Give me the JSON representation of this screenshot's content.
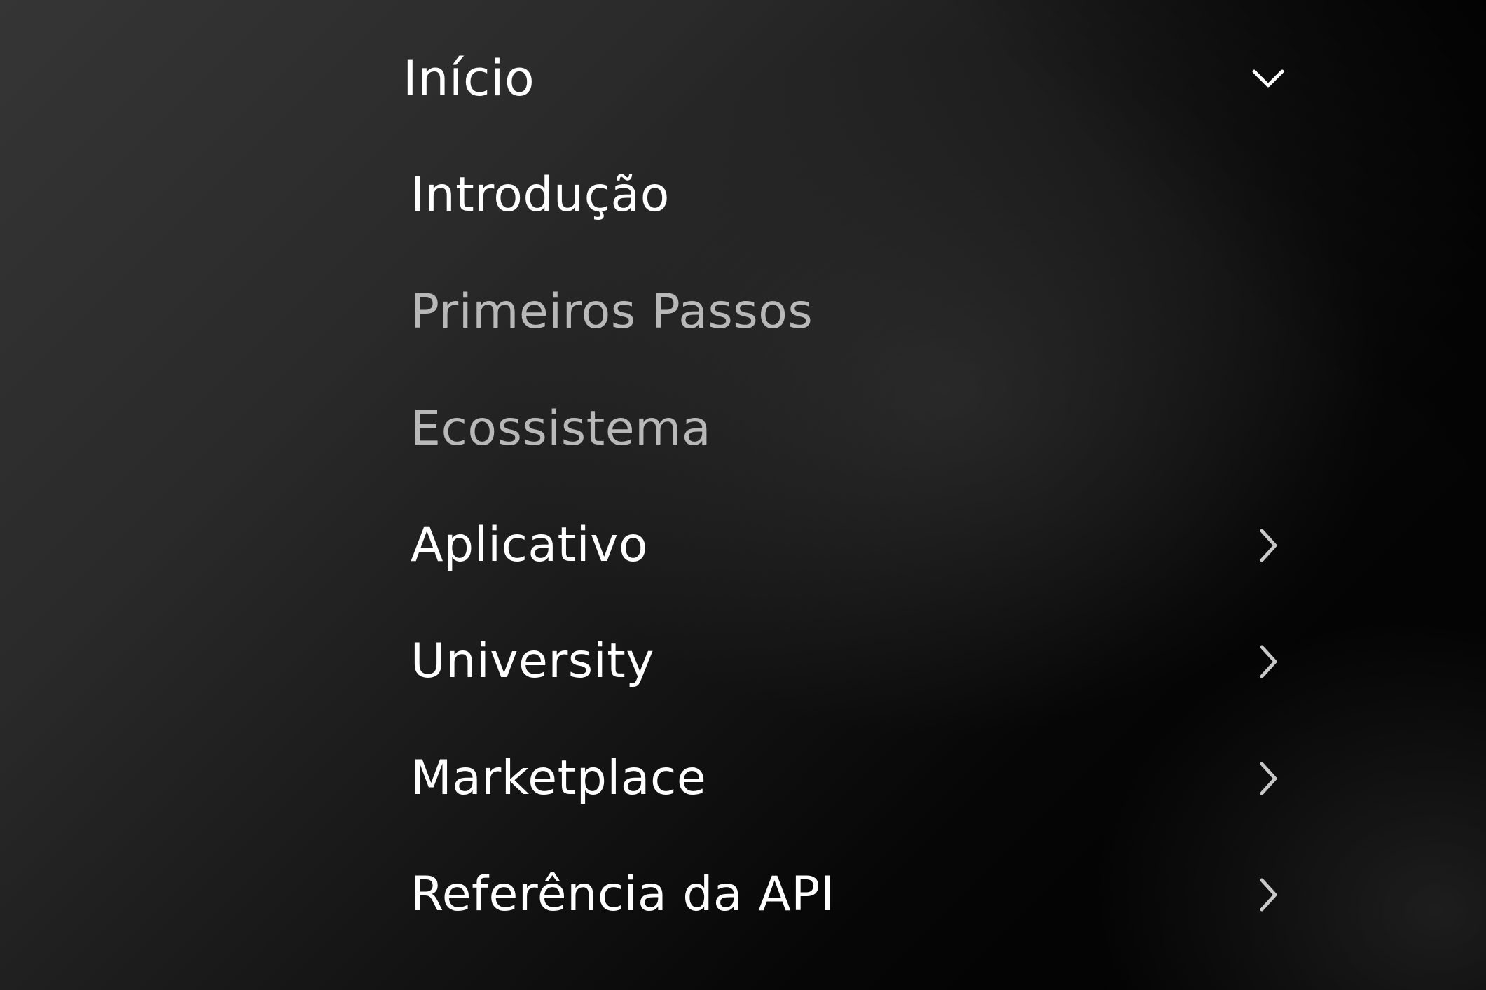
{
  "menu": {
    "section": {
      "label": "Início",
      "icon": "chevron-down-icon",
      "expanded": true
    },
    "items": [
      {
        "label": "Introdução",
        "icon": null,
        "active": true
      },
      {
        "label": "Primeiros Passos",
        "icon": null,
        "active": false
      },
      {
        "label": "Ecossistema",
        "icon": null,
        "active": false
      },
      {
        "label": "Aplicativo",
        "icon": "chevron-right-icon",
        "active": true
      },
      {
        "label": "University",
        "icon": "chevron-right-icon",
        "active": true
      },
      {
        "label": "Marketplace",
        "icon": "chevron-right-icon",
        "active": true
      },
      {
        "label": "Referência da API",
        "icon": "chevron-right-icon",
        "active": true
      }
    ]
  },
  "colors": {
    "text_primary": "#ffffff",
    "text_dim": "#b8b8b8",
    "chevron": "#c8c8c8"
  }
}
